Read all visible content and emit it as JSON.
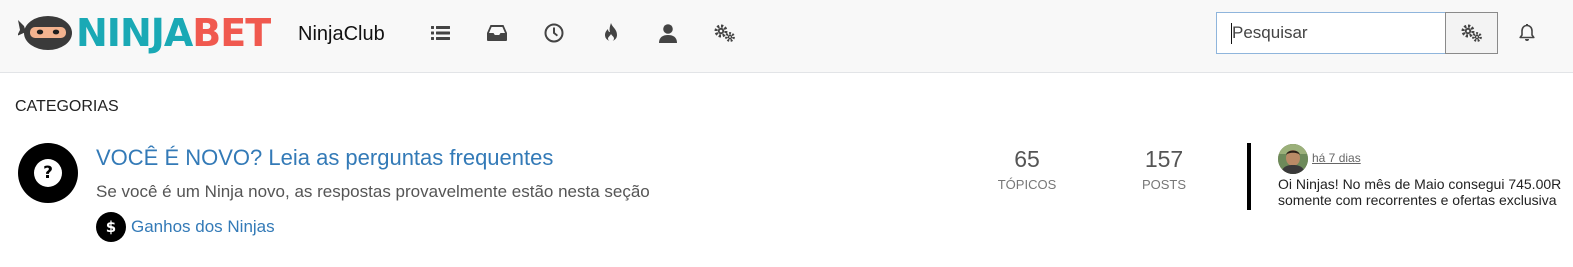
{
  "header": {
    "logo": {
      "part1": "NINJA",
      "part2": "BET"
    },
    "club_title": "NinjaClub",
    "nav_icons": [
      "list-icon",
      "inbox-icon",
      "clock-icon",
      "fire-icon",
      "user-icon",
      "gears-icon"
    ],
    "search": {
      "placeholder": "Pesquisar",
      "value": ""
    },
    "search_options_icon": "gears-icon",
    "notifications_icon": "bell-icon"
  },
  "main": {
    "section_title": "CATEGORIAS",
    "categories": [
      {
        "icon": "?",
        "title": "VOCÊ É NOVO? Leia as perguntas frequentes",
        "description": "Se você é um Ninja novo, as respostas provavelmente estão nesta seção",
        "subcategory": {
          "icon": "$",
          "label": "Ganhos dos Ninjas"
        },
        "stats": {
          "topics_value": "65",
          "topics_label": "TÓPICOS",
          "posts_value": "157",
          "posts_label": "POSTS"
        },
        "teaser": {
          "time": "há 7 dias",
          "text": "Oi Ninjas! No mês de Maio consegui 745.00R\nsomente com recorrentes e ofertas exclusiva"
        }
      }
    ]
  },
  "colors": {
    "logo_teal": "#1aa9b5",
    "logo_red": "#f0594f",
    "link_blue": "#337ab7",
    "navbar_bg": "#f8f8f8"
  }
}
